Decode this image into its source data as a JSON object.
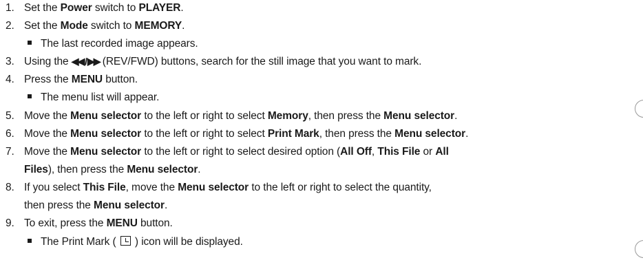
{
  "steps": [
    {
      "n": "1.",
      "parts": [
        "Set the ",
        "Power",
        " switch to ",
        "PLAYER",
        "."
      ]
    },
    {
      "n": "2.",
      "parts": [
        "Set the ",
        "Mode",
        " switch to ",
        "MEMORY",
        "."
      ]
    },
    {
      "sub": "The last recorded image appears."
    },
    {
      "n": "3.",
      "pre": "Using the ",
      "arrows": "◀◀ / ▶▶",
      "post": " (REV/FWD) buttons, search for the still image that you want to mark."
    },
    {
      "n": "4.",
      "parts": [
        "Press the ",
        "MENU",
        " button."
      ]
    },
    {
      "sub": "The menu list will appear."
    },
    {
      "n": "5.",
      "parts": [
        "Move the ",
        "Menu selector",
        " to the left or right to select ",
        "Memory",
        ", then press the ",
        "Menu selector",
        "."
      ]
    },
    {
      "n": "6.",
      "parts": [
        "Move the ",
        "Menu selector",
        " to the left or right to select ",
        "Print Mark",
        ", then press the ",
        "Menu selector",
        "."
      ]
    },
    {
      "n": "7.",
      "parts": [
        "Move the ",
        "Menu selector",
        " to the left or right to select desired option (",
        "All Off",
        ", ",
        "This File",
        " or ",
        "All"
      ]
    },
    {
      "cont": [
        "",
        "Files",
        "), then press the ",
        "Menu selector",
        "."
      ]
    },
    {
      "n": "8.",
      "parts": [
        "If you select ",
        "This File",
        ", move the ",
        "Menu selector",
        " to the left or right to select the quantity,"
      ]
    },
    {
      "cont": [
        "then press the ",
        "Menu selector",
        "."
      ]
    },
    {
      "n": "9.",
      "parts": [
        "To exit, press the ",
        "MENU",
        " button."
      ]
    },
    {
      "sub_pre": "The Print Mark ( ",
      "sub_post": " ) icon will be displayed."
    }
  ]
}
